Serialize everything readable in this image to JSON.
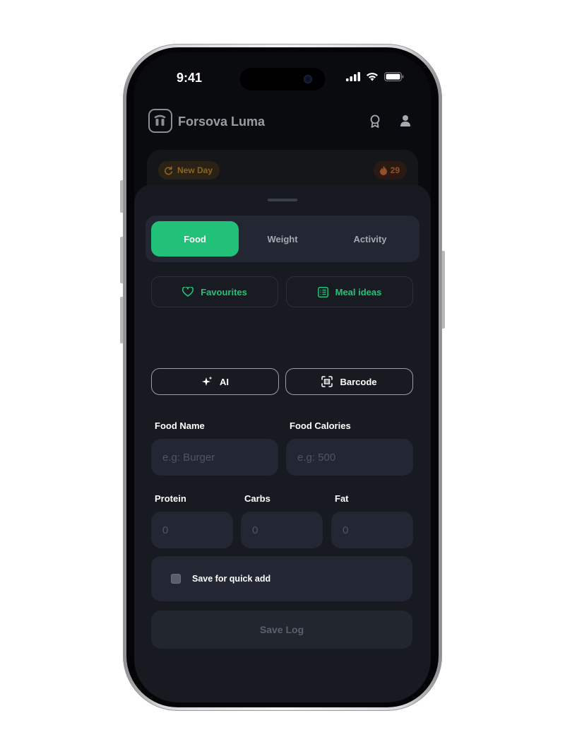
{
  "status_bar": {
    "time": "9:41"
  },
  "header": {
    "app_name": "Forsova Luma"
  },
  "streak_card": {
    "new_day_label": "New Day",
    "streak_count": "29"
  },
  "tabs": [
    {
      "label": "Food",
      "active": true
    },
    {
      "label": "Weight",
      "active": false
    },
    {
      "label": "Activity",
      "active": false
    }
  ],
  "quick_actions": {
    "favourites": "Favourites",
    "meal_ideas": "Meal ideas",
    "ai": "AI",
    "barcode": "Barcode"
  },
  "form": {
    "food_name_label": "Food Name",
    "food_name_placeholder": "e.g: Burger",
    "food_calories_label": "Food Calories",
    "food_calories_placeholder": "e.g: 500",
    "protein_label": "Protein",
    "protein_placeholder": "0",
    "carbs_label": "Carbs",
    "carbs_placeholder": "0",
    "fat_label": "Fat",
    "fat_placeholder": "0",
    "quick_add_label": "Save for quick add",
    "quick_add_checked": false,
    "save_label": "Save Log"
  },
  "colors": {
    "accent": "#22c179",
    "sheet_bg": "#171a21",
    "field_bg": "#232733"
  },
  "icons": {
    "favourites": "heart-icon",
    "meal_ideas": "list-icon",
    "ai": "sparkle-icon",
    "barcode": "barcode-icon",
    "award": "award-icon",
    "profile": "user-icon",
    "new_day": "refresh-icon",
    "streak": "flame-icon"
  }
}
